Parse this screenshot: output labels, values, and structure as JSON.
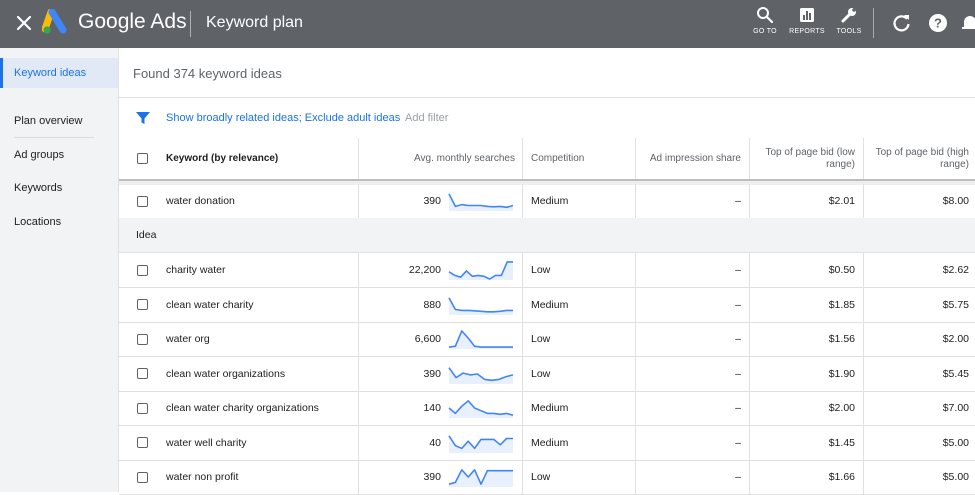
{
  "topbar": {
    "brand": "Google Ads",
    "title": "Keyword plan",
    "goto_label": "GO TO",
    "reports_label": "REPORTS",
    "tools_label": "TOOLS",
    "bg_color": "#5f6368"
  },
  "sidebar": {
    "items": [
      {
        "label": "Keyword ideas",
        "active": true
      },
      {
        "label": "Plan overview"
      },
      {
        "label": "Ad groups"
      },
      {
        "label": "Keywords"
      },
      {
        "label": "Locations"
      }
    ]
  },
  "main": {
    "found_text": "Found 374 keyword ideas",
    "filter_text": "Show broadly related ideas; Exclude adult ideas",
    "add_filter": "Add filter"
  },
  "table": {
    "headers": {
      "keyword": "Keyword (by relevance)",
      "avg": "Avg. monthly searches",
      "competition": "Competition",
      "impression": "Ad impression share",
      "low": "Top of page bid (low range)",
      "high": "Top of page bid (high range)"
    },
    "top_rows": [
      {
        "keyword": "water donation",
        "avg": "390",
        "competition": "Medium",
        "share": "–",
        "low": "$2.01",
        "high": "$8.00",
        "trend": [
          0.9,
          0.2,
          0.3,
          0.25,
          0.25,
          0.25,
          0.2,
          0.18,
          0.2,
          0.15,
          0.25
        ]
      }
    ],
    "group_label": "Idea",
    "rows": [
      {
        "keyword": "charity water",
        "avg": "22,200",
        "competition": "Low",
        "share": "–",
        "low": "$0.50",
        "high": "$2.62",
        "trend": [
          0.4,
          0.2,
          0.1,
          0.45,
          0.15,
          0.2,
          0.15,
          0.0,
          0.2,
          0.2,
          0.95,
          0.95
        ]
      },
      {
        "keyword": "clean water charity",
        "avg": "880",
        "competition": "Medium",
        "share": "–",
        "low": "$1.85",
        "high": "$5.75",
        "trend": [
          0.9,
          0.25,
          0.2,
          0.2,
          0.18,
          0.15,
          0.12,
          0.12,
          0.15,
          0.2,
          0.2
        ]
      },
      {
        "keyword": "water org",
        "avg": "6,600",
        "competition": "Low",
        "share": "–",
        "low": "$1.56",
        "high": "$2.00",
        "trend": [
          0.05,
          0.1,
          0.95,
          0.55,
          0.1,
          0.05,
          0.05,
          0.05,
          0.05,
          0.05,
          0.05
        ]
      },
      {
        "keyword": "clean water organizations",
        "avg": "390",
        "competition": "Low",
        "share": "–",
        "low": "$1.90",
        "high": "$5.45",
        "trend": [
          0.85,
          0.3,
          0.55,
          0.45,
          0.5,
          0.2,
          0.15,
          0.2,
          0.35,
          0.45
        ]
      },
      {
        "keyword": "clean water charity organizations",
        "avg": "140",
        "competition": "Medium",
        "share": "–",
        "low": "$2.00",
        "high": "$7.00",
        "trend": [
          0.5,
          0.2,
          0.6,
          0.9,
          0.5,
          0.35,
          0.2,
          0.2,
          0.15,
          0.2,
          0.1
        ]
      },
      {
        "keyword": "water well charity",
        "avg": "40",
        "competition": "Medium",
        "share": "–",
        "low": "$1.45",
        "high": "$5.00",
        "trend": [
          0.9,
          0.35,
          0.2,
          0.6,
          0.2,
          0.7,
          0.7,
          0.7,
          0.4,
          0.75,
          0.75
        ]
      },
      {
        "keyword": "water non profit",
        "avg": "390",
        "competition": "Low",
        "share": "–",
        "low": "$1.66",
        "high": "$5.00",
        "trend": [
          0.1,
          0.2,
          0.9,
          0.5,
          0.9,
          0.1,
          0.85,
          0.85,
          0.85,
          0.85,
          0.85
        ]
      }
    ],
    "spark_color": "#4285f4",
    "spark_fill": "#e8f0fe"
  }
}
